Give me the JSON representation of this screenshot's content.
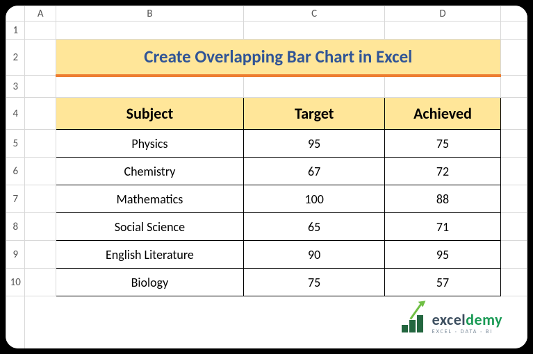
{
  "columns": [
    "A",
    "B",
    "C",
    "D"
  ],
  "rows": [
    "1",
    "2",
    "3",
    "4",
    "5",
    "6",
    "7",
    "8",
    "9",
    "10"
  ],
  "title": "Create Overlapping Bar Chart in Excel",
  "table": {
    "headers": {
      "subject": "Subject",
      "target": "Target",
      "achieved": "Achieved"
    },
    "rows": [
      {
        "subject": "Physics",
        "target": "95",
        "achieved": "75"
      },
      {
        "subject": "Chemistry",
        "target": "67",
        "achieved": "72"
      },
      {
        "subject": "Mathematics",
        "target": "100",
        "achieved": "88"
      },
      {
        "subject": "Social Science",
        "target": "65",
        "achieved": "71"
      },
      {
        "subject": "English Literature",
        "target": "90",
        "achieved": "95"
      },
      {
        "subject": "Biology",
        "target": "75",
        "achieved": "57"
      }
    ]
  },
  "logo": {
    "main_a": "excel",
    "main_b": "demy",
    "sub": "EXCEL · DATA · BI"
  },
  "chart_data": {
    "type": "table",
    "title": "Create Overlapping Bar Chart in Excel",
    "columns": [
      "Subject",
      "Target",
      "Achieved"
    ],
    "rows": [
      [
        "Physics",
        95,
        75
      ],
      [
        "Chemistry",
        67,
        72
      ],
      [
        "Mathematics",
        100,
        88
      ],
      [
        "Social Science",
        65,
        71
      ],
      [
        "English Literature",
        90,
        95
      ],
      [
        "Biology",
        75,
        57
      ]
    ]
  }
}
